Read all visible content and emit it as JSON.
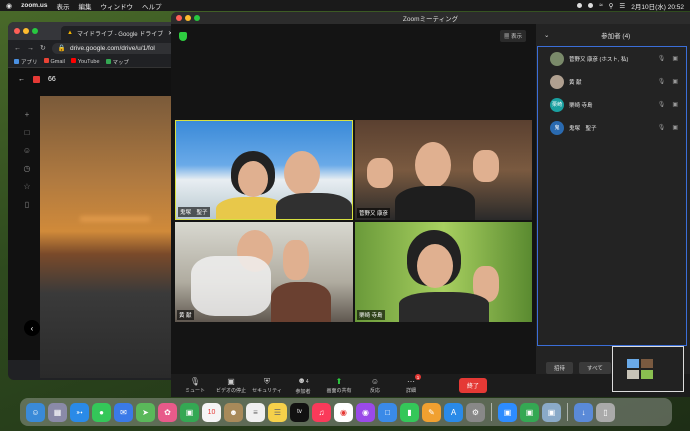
{
  "menubar": {
    "app": "zoom.us",
    "menus": [
      "表示",
      "編集",
      "ウィンドウ",
      "ヘルプ"
    ],
    "datetime": "2月10日(水) 20:52"
  },
  "chrome": {
    "tab_title": "マイドライブ - Google ドライブ",
    "url": "drive.google.com/drive/u/1/fol",
    "bookmarks": [
      "アプリ",
      "Gmail",
      "YouTube",
      "マップ"
    ],
    "photo_count": "66"
  },
  "zoom": {
    "window_title": "Zoomミーティング",
    "view_button": "表示",
    "tiles": [
      {
        "name": "鬼塚　聖子"
      },
      {
        "name": "菅野又 康彦"
      },
      {
        "name": "黄 献"
      },
      {
        "name": "栗崎 寺島"
      }
    ],
    "toolbar": {
      "mute": "ミュート",
      "video": "ビデオの停止",
      "security": "セキュリティ",
      "participants": "参加者",
      "participants_count": "4",
      "share": "画面の共有",
      "reactions": "反応",
      "more": "詳細",
      "more_badge": "1",
      "end": "終了"
    },
    "panel": {
      "title": "参加者 (4)",
      "participants": [
        {
          "name": "菅野又 康彦 (ホスト, 私)",
          "avatar_color": "#7a8a6a",
          "initials": ""
        },
        {
          "name": "黄 献",
          "avatar_color": "#b0a090",
          "initials": ""
        },
        {
          "name": "栗崎 寺島",
          "avatar_color": "#1aa0a0",
          "initials": "栗崎"
        },
        {
          "name": "鬼塚　聖子",
          "avatar_color": "#2a6ab0",
          "initials": "鬼"
        }
      ],
      "invite": "招待",
      "mute_all": "すべて"
    }
  }
}
